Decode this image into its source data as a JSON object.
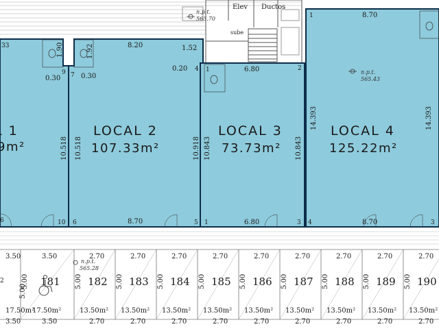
{
  "colors": {
    "unit_fill": "#8ecbdc",
    "unit_stroke": "#0d2d4a",
    "line": "#888888"
  },
  "top": {
    "elev": "Elev",
    "ductos": "Ductos",
    "sube": "sube",
    "npt_label": "n.p.t.",
    "npt_value": "563.70"
  },
  "locales": [
    {
      "name": "L 1",
      "area": "9m²",
      "corner_tl": "33",
      "corner_bl": "6",
      "dims": [
        "0.30",
        "1.90",
        "9"
      ]
    },
    {
      "name": "LOCAL 2",
      "area": "107.33m²",
      "corner_tr": "1.52",
      "corner_bl": "6",
      "corner_br": "10",
      "dims": [
        "8.20",
        "8.70",
        "10.518",
        "10.518",
        "1.92",
        "7",
        "0.30",
        "0.20",
        "4"
      ]
    },
    {
      "name": "LOCAL 3",
      "area": "73.73m²",
      "corner_tl": "1",
      "corner_tr": "2",
      "corner_bl": "5",
      "corner_br": "3",
      "dims": [
        "6.80",
        "6.80",
        "10.918",
        "10.843",
        "10.843",
        "3"
      ]
    },
    {
      "name": "LOCAL 4",
      "area": "125.22m²",
      "corner_tl": "1",
      "corner_bl": "4",
      "corner_br": "3",
      "dims": [
        "8.70",
        "8.70",
        "14.393",
        "14.393"
      ],
      "npt_label": "n.p.t.",
      "npt_value": "565.43"
    }
  ],
  "parking": {
    "npt_label": "n.p.t.",
    "npt_value": "565.28",
    "left_top": "3.50",
    "left_bottom": "3.50",
    "left_area": "17.50m²",
    "left_side": "5.00",
    "edge_num": "2",
    "stalls": [
      {
        "num": "181",
        "top": "3.50",
        "bottom": "3.50",
        "side": "5.00",
        "area": "17.50m²"
      },
      {
        "num": "182",
        "top": "2.70",
        "bottom": "2.70",
        "side": "5.00",
        "area": "13.50m²"
      },
      {
        "num": "183",
        "top": "2.70",
        "bottom": "2.70",
        "side": "5.00",
        "area": "13.50m²"
      },
      {
        "num": "184",
        "top": "2.70",
        "bottom": "2.70",
        "side": "5.00",
        "area": "13.50m²"
      },
      {
        "num": "185",
        "top": "2.70",
        "bottom": "2.70",
        "side": "5.00",
        "area": "13.50m²"
      },
      {
        "num": "186",
        "top": "2.70",
        "bottom": "2.70",
        "side": "5.00",
        "area": "13.50m²"
      },
      {
        "num": "187",
        "top": "2.70",
        "bottom": "2.70",
        "side": "5.00",
        "area": "13.50m²"
      },
      {
        "num": "188",
        "top": "2.70",
        "bottom": "2.70",
        "side": "5.00",
        "area": "13.50m²"
      },
      {
        "num": "189",
        "top": "2.70",
        "bottom": "2.70",
        "side": "5.00",
        "area": "13.50m²"
      },
      {
        "num": "190",
        "top": "2.70",
        "bottom": "2.70",
        "side": "5.00",
        "area": "13.50m²"
      }
    ]
  }
}
